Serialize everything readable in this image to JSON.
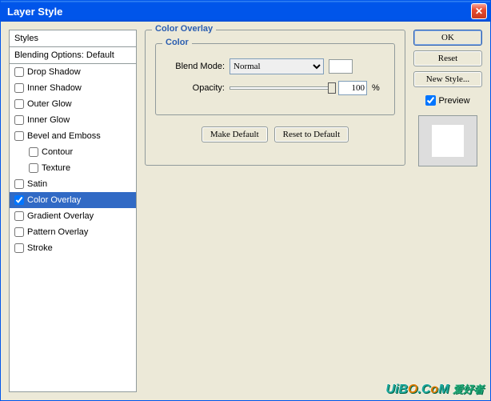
{
  "window": {
    "title": "Layer Style"
  },
  "stylesPanel": {
    "header": "Styles",
    "subheader": "Blending Options: Default",
    "items": [
      {
        "label": "Drop Shadow",
        "checked": false,
        "indent": false
      },
      {
        "label": "Inner Shadow",
        "checked": false,
        "indent": false
      },
      {
        "label": "Outer Glow",
        "checked": false,
        "indent": false
      },
      {
        "label": "Inner Glow",
        "checked": false,
        "indent": false
      },
      {
        "label": "Bevel and Emboss",
        "checked": false,
        "indent": false
      },
      {
        "label": "Contour",
        "checked": false,
        "indent": true
      },
      {
        "label": "Texture",
        "checked": false,
        "indent": true
      },
      {
        "label": "Satin",
        "checked": false,
        "indent": false
      },
      {
        "label": "Color Overlay",
        "checked": true,
        "indent": false,
        "selected": true
      },
      {
        "label": "Gradient Overlay",
        "checked": false,
        "indent": false
      },
      {
        "label": "Pattern Overlay",
        "checked": false,
        "indent": false
      },
      {
        "label": "Stroke",
        "checked": false,
        "indent": false
      }
    ]
  },
  "main": {
    "groupTitle": "Color Overlay",
    "colorGroup": "Color",
    "blendModeLabel": "Blend Mode:",
    "blendModeValue": "Normal",
    "opacityLabel": "Opacity:",
    "opacityValue": "100",
    "opacityUnit": "%",
    "makeDefault": "Make Default",
    "resetDefault": "Reset to Default",
    "swatchColor": "#ffffff"
  },
  "right": {
    "ok": "OK",
    "reset": "Reset",
    "newStyle": "New Style...",
    "preview": "Preview",
    "previewChecked": true
  },
  "watermark": "UiBO.CoM"
}
